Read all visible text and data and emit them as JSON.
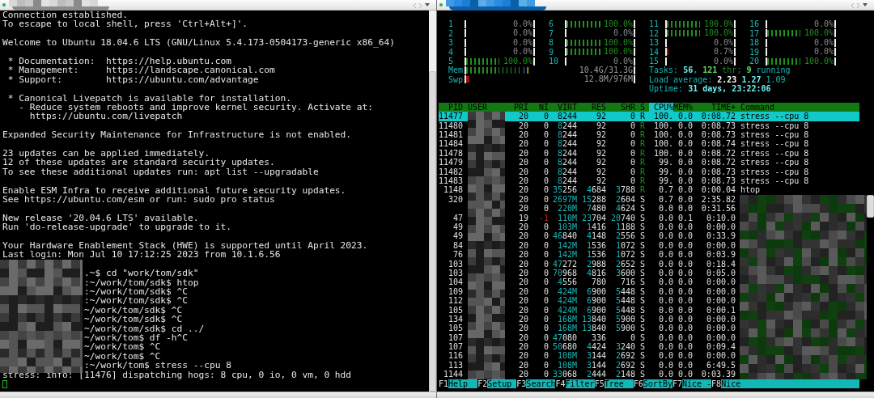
{
  "left_terminal": {
    "blocks": [
      {
        "lines": [
          {
            "kind": "output",
            "text": "Connection established."
          },
          {
            "kind": "output",
            "text": "To escape to local shell, press 'Ctrl+Alt+]'."
          }
        ]
      },
      {
        "lines": [
          {
            "kind": "output",
            "text": "Welcome to Ubuntu 18.04.6 LTS (GNU/Linux 5.4.173-0504173-generic x86_64)"
          }
        ]
      },
      {
        "lines": [
          {
            "kind": "output",
            "text": " * Documentation:  https://help.ubuntu.com"
          },
          {
            "kind": "output",
            "text": " * Management:     https://landscape.canonical.com"
          },
          {
            "kind": "output",
            "text": " * Support:        https://ubuntu.com/advantage"
          }
        ]
      },
      {
        "lines": [
          {
            "kind": "output",
            "text": " * Canonical Livepatch is available for installation."
          },
          {
            "kind": "output",
            "text": "   - Reduce system reboots and improve kernel security. Activate at:"
          },
          {
            "kind": "output",
            "text": "     https://ubuntu.com/livepatch"
          }
        ]
      },
      {
        "lines": [
          {
            "kind": "output",
            "text": "Expanded Security Maintenance for Infrastructure is not enabled."
          }
        ]
      },
      {
        "lines": [
          {
            "kind": "output",
            "text": "23 updates can be applied immediately."
          },
          {
            "kind": "output",
            "text": "12 of these updates are standard security updates."
          },
          {
            "kind": "output",
            "text": "To see these additional updates run: apt list --upgradable"
          }
        ]
      },
      {
        "lines": [
          {
            "kind": "output",
            "text": "Enable ESM Infra to receive additional future security updates."
          },
          {
            "kind": "output",
            "text": "See https://ubuntu.com/esm or run: sudo pro status"
          }
        ]
      },
      {
        "lines": [
          {
            "kind": "output",
            "text": "New release '20.04.6 LTS' available."
          },
          {
            "kind": "output",
            "text": "Run 'do-release-upgrade' to upgrade to it."
          }
        ]
      },
      {
        "lines": [
          {
            "kind": "output",
            "text": "Your Hardware Enablement Stack (HWE) is supported until April 2023."
          },
          {
            "kind": "output",
            "text": "Last login: Mon Jul 10 17:12:25 2023 from 10.1.6.56"
          }
        ]
      },
      {
        "lines": [
          {
            "kind": "prompt",
            "text": ".~$ cd \"work/tom/sdk\""
          },
          {
            "kind": "prompt",
            "text": ":~/work/tom/sdk$ htop"
          },
          {
            "kind": "prompt",
            "text": ":~/work/tom/sdk$ ^C"
          },
          {
            "kind": "prompt",
            "text": ":~/work/tom/sdk$ ^C"
          },
          {
            "kind": "prompt",
            "text": "~/work/tom/sdk$ ^C"
          },
          {
            "kind": "prompt",
            "text": "~/work/tom/sdk$ ^C"
          },
          {
            "kind": "prompt",
            "text": "~/work/tom/sdk$ cd ../"
          },
          {
            "kind": "prompt",
            "text": "~/work/tom$ df -h^C"
          },
          {
            "kind": "prompt",
            "text": "~/work/tom$ ^C"
          },
          {
            "kind": "prompt",
            "text": "~/work/tom$ ^C"
          },
          {
            "kind": "prompt",
            "text": ":~/work/tom$ stress --cpu 8"
          },
          {
            "kind": "output",
            "text": "stress: info: [11476] dispatching hogs: 8 cpu, 0 io, 0 vm, 0 hdd"
          },
          {
            "kind": "cursor"
          }
        ]
      }
    ]
  },
  "htop": {
    "cpus": [
      {
        "label": "1",
        "level": 0,
        "reading": "0.0%"
      },
      {
        "label": "2",
        "level": 0,
        "reading": "0.0%"
      },
      {
        "label": "3",
        "level": 0,
        "reading": "0.0%"
      },
      {
        "label": "4",
        "level": 0,
        "reading": "0.0%"
      },
      {
        "label": "5",
        "level": 1,
        "reading": "100.0%",
        "color": "#1f8f1f"
      },
      {
        "label": "6",
        "level": 1,
        "reading": "100.0%",
        "color": "#1f8f1f"
      },
      {
        "label": "7",
        "level": 0,
        "reading": "0.0%"
      },
      {
        "label": "8",
        "level": 1,
        "reading": "100.0%",
        "color": "#1f8f1f"
      },
      {
        "label": "9",
        "level": 1,
        "reading": "100.0%",
        "color": "#1f8f1f"
      },
      {
        "label": "10",
        "level": 0,
        "reading": "0.0%"
      },
      {
        "label": "11",
        "level": 1,
        "reading": "100.0%",
        "color": "#1f8f1f"
      },
      {
        "label": "12",
        "level": 1,
        "reading": "100.0%",
        "color": "#1f8f1f"
      },
      {
        "label": "13",
        "level": 0,
        "reading": "0.0%"
      },
      {
        "label": "14",
        "level": 0.03,
        "reading": "0.7%",
        "color": "#a01010"
      },
      {
        "label": "15",
        "level": 0,
        "reading": "0.0%"
      },
      {
        "label": "16",
        "level": 0,
        "reading": "0.0%"
      },
      {
        "label": "17",
        "level": 1,
        "reading": "100.0%",
        "color": "#1f8f1f"
      },
      {
        "label": "18",
        "level": 0,
        "reading": "0.0%"
      },
      {
        "label": "19",
        "level": 0,
        "reading": "0.0%"
      },
      {
        "label": "20",
        "level": 1,
        "reading": "100.0%",
        "color": "#1f8f1f"
      }
    ],
    "memory": {
      "label": "Mem",
      "reading": "10.4G/31.3G",
      "level": 0.37,
      "color": "#1f8f1f"
    },
    "swap": {
      "label": "Swp",
      "reading": "12.8M/976M",
      "level": 0.02,
      "color": "#a01010"
    },
    "tasks": [
      {
        "kind": "label",
        "text": "Tasks: "
      },
      {
        "kind": "value",
        "text": "56"
      },
      {
        "kind": "label",
        "text": ", "
      },
      {
        "kind": "green-value",
        "text": "121"
      },
      {
        "kind": "green",
        "text": " thr; "
      },
      {
        "kind": "green-value",
        "text": "9"
      },
      {
        "kind": "label",
        "text": " running"
      }
    ],
    "load_average": [
      {
        "kind": "label",
        "text": "Load average: "
      },
      {
        "kind": "white-value",
        "text": "2.23 "
      },
      {
        "kind": "value",
        "text": "1.27"
      },
      {
        "kind": "label",
        "text": " 1.09"
      }
    ],
    "uptime": [
      {
        "kind": "label",
        "text": "Uptime: "
      },
      {
        "kind": "value",
        "text": "31 days, 23:22:06"
      }
    ],
    "columns": [
      {
        "label": "PID",
        "selected": false
      },
      {
        "label": "USER",
        "selected": false
      },
      {
        "label": "PRI",
        "selected": false
      },
      {
        "label": "NI",
        "selected": false
      },
      {
        "label": "VIRT",
        "selected": false
      },
      {
        "label": "RES",
        "selected": false
      },
      {
        "label": "SHR",
        "selected": false
      },
      {
        "label": "S",
        "selected": false
      },
      {
        "label": "CPU%",
        "selected": true
      },
      {
        "label": "MEM%",
        "selected": false
      },
      {
        "label": "TIME+",
        "selected": false
      },
      {
        "label": "Command",
        "selected": false
      }
    ],
    "processes": [
      {
        "pid": "11477",
        "pri": "20",
        "ni": "0",
        "virt": "8244",
        "res": "92",
        "shr": "0",
        "s": "R",
        "running": true,
        "cpu": "100.",
        "mem": "0.0",
        "time": "0:08.72",
        "command": "stress --cpu 8",
        "selected": true
      },
      {
        "pid": "11480",
        "pri": "20",
        "ni": "0",
        "virt": "8244",
        "res": "92",
        "shr": "0",
        "s": "R",
        "running": true,
        "cpu": "100.",
        "mem": "0.0",
        "time": "0:08.73",
        "command": "stress --cpu 8",
        "selected": false
      },
      {
        "pid": "11481",
        "pri": "20",
        "ni": "0",
        "virt": "8244",
        "res": "92",
        "shr": "0",
        "s": "R",
        "running": true,
        "cpu": "100.",
        "mem": "0.0",
        "time": "0:08.73",
        "command": "stress --cpu 8",
        "selected": false
      },
      {
        "pid": "11484",
        "pri": "20",
        "ni": "0",
        "virt": "8244",
        "res": "92",
        "shr": "0",
        "s": "R",
        "running": true,
        "cpu": "100.",
        "mem": "0.0",
        "time": "0:08.74",
        "command": "stress --cpu 8",
        "selected": false
      },
      {
        "pid": "11478",
        "pri": "20",
        "ni": "0",
        "virt": "8244",
        "res": "92",
        "shr": "0",
        "s": "R",
        "running": true,
        "cpu": "100.",
        "mem": "0.0",
        "time": "0:08.72",
        "command": "stress --cpu 8",
        "selected": false
      },
      {
        "pid": "11479",
        "pri": "20",
        "ni": "0",
        "virt": "8244",
        "res": "92",
        "shr": "0",
        "s": "R",
        "running": true,
        "cpu": "99.",
        "mem": "0.0",
        "time": "0:08.72",
        "command": "stress --cpu 8",
        "selected": false
      },
      {
        "pid": "11482",
        "pri": "20",
        "ni": "0",
        "virt": "8244",
        "res": "92",
        "shr": "0",
        "s": "R",
        "running": true,
        "cpu": "99.",
        "mem": "0.0",
        "time": "0:08.73",
        "command": "stress --cpu 8",
        "selected": false
      },
      {
        "pid": "11483",
        "pri": "20",
        "ni": "0",
        "virt": "8244",
        "res": "92",
        "shr": "0",
        "s": "R",
        "running": true,
        "cpu": "99.",
        "mem": "0.0",
        "time": "0:08.73",
        "command": "stress --cpu 8",
        "selected": false
      },
      {
        "pid": "1148",
        "pri": "20",
        "ni": "0",
        "virt": "35256",
        "res": "4684",
        "shr": "3788",
        "s": "R",
        "running": true,
        "cpu": "0.7",
        "mem": "0.0",
        "time": "0:00.04",
        "command": "htop",
        "selected": false
      },
      {
        "pid": "320",
        "pri": "20",
        "ni": "0",
        "virt": "2697M",
        "res": "15288",
        "shr": "2604",
        "s": "S",
        "running": false,
        "cpu": "0.7",
        "mem": "0.0",
        "time": "2:35.82",
        "selected": false
      },
      {
        "pri": "20",
        "ni": "0",
        "virt": "220M",
        "res": "7480",
        "shr": "4624",
        "s": "S",
        "running": false,
        "cpu": "0.0",
        "mem": "0.0",
        "time": "0:31.56",
        "selected": false
      },
      {
        "pid": "47",
        "pri": "19",
        "ni": "-1",
        "virt": "110M",
        "res": "23704",
        "shr": "20740",
        "s": "S",
        "running": false,
        "cpu": "0.0",
        "mem": "0.1",
        "time": "0:10.0",
        "selected": false
      },
      {
        "pid": "49",
        "pri": "20",
        "ni": "0",
        "virt": "103M",
        "res": "1416",
        "shr": "1188",
        "s": "S",
        "running": false,
        "cpu": "0.0",
        "mem": "0.0",
        "time": "0:00.0",
        "selected": false
      },
      {
        "pid": "49",
        "pri": "20",
        "ni": "0",
        "virt": "46840",
        "res": "4148",
        "shr": "2556",
        "s": "S",
        "running": false,
        "cpu": "0.0",
        "mem": "0.0",
        "time": "0:33.9",
        "selected": false
      },
      {
        "pid": "84",
        "pri": "20",
        "ni": "0",
        "virt": "142M",
        "res": "1536",
        "shr": "1072",
        "s": "S",
        "running": false,
        "cpu": "0.0",
        "mem": "0.0",
        "time": "0:00.0",
        "selected": false
      },
      {
        "pid": "76",
        "pri": "20",
        "ni": "0",
        "virt": "142M",
        "res": "1536",
        "shr": "1072",
        "s": "S",
        "running": false,
        "cpu": "0.0",
        "mem": "0.0",
        "time": "0:03.9",
        "selected": false
      },
      {
        "pid": "103",
        "pri": "20",
        "ni": "0",
        "virt": "47272",
        "res": "2988",
        "shr": "2652",
        "s": "S",
        "running": false,
        "cpu": "0.0",
        "mem": "0.0",
        "time": "0:18.4",
        "selected": false
      },
      {
        "pid": "103",
        "pri": "20",
        "ni": "0",
        "virt": "70968",
        "res": "4816",
        "shr": "3600",
        "s": "S",
        "running": false,
        "cpu": "0.0",
        "mem": "0.0",
        "time": "0:05.0",
        "selected": false
      },
      {
        "pid": "104",
        "pri": "20",
        "ni": "0",
        "virt": "4556",
        "res": "780",
        "shr": "716",
        "s": "S",
        "running": false,
        "cpu": "0.0",
        "mem": "0.0",
        "time": "0:00.0",
        "selected": false
      },
      {
        "pid": "109",
        "pri": "20",
        "ni": "0",
        "virt": "424M",
        "res": "6900",
        "shr": "5448",
        "s": "S",
        "running": false,
        "cpu": "0.0",
        "mem": "0.0",
        "time": "0:00.0",
        "selected": false
      },
      {
        "pid": "112",
        "pri": "20",
        "ni": "0",
        "virt": "424M",
        "res": "6900",
        "shr": "5448",
        "s": "S",
        "running": false,
        "cpu": "0.0",
        "mem": "0.0",
        "time": "0:00.0",
        "selected": false
      },
      {
        "pid": "105",
        "pri": "20",
        "ni": "0",
        "virt": "424M",
        "res": "6900",
        "shr": "5448",
        "s": "S",
        "running": false,
        "cpu": "0.0",
        "mem": "0.0",
        "time": "0:00.1",
        "selected": false
      },
      {
        "pid": "134",
        "pri": "20",
        "ni": "0",
        "virt": "168M",
        "res": "13840",
        "shr": "5900",
        "s": "S",
        "running": false,
        "cpu": "0.0",
        "mem": "0.0",
        "time": "0:00.0",
        "selected": false
      },
      {
        "pid": "105",
        "pri": "20",
        "ni": "0",
        "virt": "168M",
        "res": "13840",
        "shr": "5900",
        "s": "S",
        "running": false,
        "cpu": "0.0",
        "mem": "0.0",
        "time": "0:00.0",
        "selected": false
      },
      {
        "pid": "107",
        "pri": "20",
        "ni": "0",
        "virt": "47080",
        "res": "336",
        "shr": "0",
        "s": "S",
        "running": false,
        "cpu": "0.0",
        "mem": "0.0",
        "time": "0:00.0",
        "selected": false
      },
      {
        "pid": "107",
        "pri": "20",
        "ni": "0",
        "virt": "50680",
        "res": "4424",
        "shr": "3240",
        "s": "S",
        "running": false,
        "cpu": "0.0",
        "mem": "0.0",
        "time": "0:09.4",
        "selected": false
      },
      {
        "pid": "116",
        "pri": "20",
        "ni": "0",
        "virt": "108M",
        "res": "3144",
        "shr": "2692",
        "s": "S",
        "running": false,
        "cpu": "0.0",
        "mem": "0.0",
        "time": "0:00.0",
        "selected": false
      },
      {
        "pid": "113",
        "pri": "20",
        "ni": "0",
        "virt": "108M",
        "res": "3144",
        "shr": "2692",
        "s": "S",
        "running": false,
        "cpu": "0.0",
        "mem": "0.0",
        "time": "6:49.5",
        "selected": false
      },
      {
        "pid": "1144",
        "pri": "20",
        "ni": "0",
        "virt": "33068",
        "res": "2444",
        "shr": "2148",
        "s": "S",
        "running": false,
        "cpu": "0.0",
        "mem": "0.0",
        "time": "0:03.39",
        "selected": false
      }
    ],
    "function_keys": [
      {
        "key": "F1",
        "label": "Help"
      },
      {
        "key": "F2",
        "label": "Setup"
      },
      {
        "key": "F3",
        "label": "Search"
      },
      {
        "key": "F4",
        "label": "Filter"
      },
      {
        "key": "F5",
        "label": "Tree"
      },
      {
        "key": "F6",
        "label": "SortBy"
      },
      {
        "key": "F7",
        "label": "Nice -"
      },
      {
        "key": "F8",
        "label": "Nice"
      }
    ]
  }
}
